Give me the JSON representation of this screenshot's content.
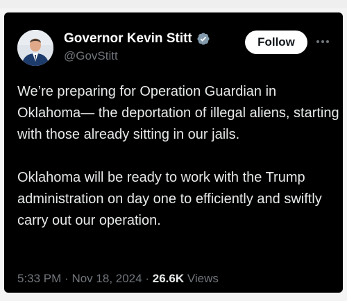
{
  "tweet": {
    "author": {
      "name": "Governor Kevin Stitt",
      "handle": "@GovStitt",
      "verified": true
    },
    "follow_label": "Follow",
    "more_icon": "more-horizontal-icon",
    "paragraphs": [
      "We’re preparing for Operation Guardian in Oklahoma— the deportation of illegal aliens, starting with those already sitting in our jails.",
      "Oklahoma will be ready to work with the Trump administration on day one to efficiently and swiftly carry out our operation."
    ],
    "time": "5:33 PM",
    "date": "Nov 18, 2024",
    "separator": "·",
    "views_count": "26.6K",
    "views_label": "Views"
  },
  "colors": {
    "background": "#000000",
    "text": "#e7e9ea",
    "muted": "#71767b",
    "verified_badge": "#829aab",
    "follow_bg": "#ffffff"
  }
}
